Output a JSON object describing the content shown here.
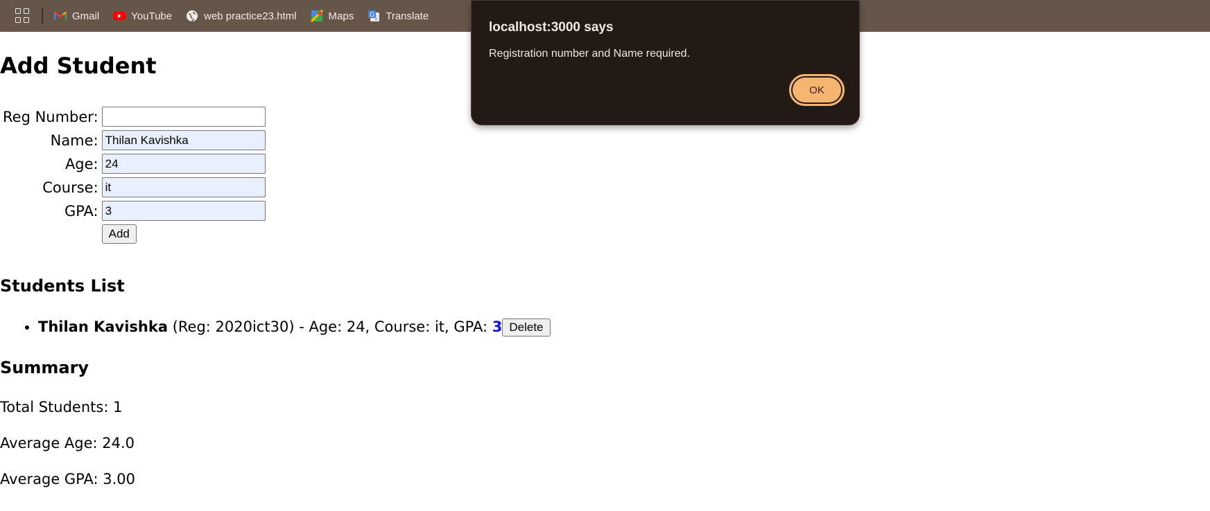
{
  "bookmarks_bar": {
    "items": [
      {
        "label": "Gmail",
        "icon": "gmail-icon"
      },
      {
        "label": "YouTube",
        "icon": "youtube-icon"
      },
      {
        "label": "web practice23.html",
        "icon": "globe-icon"
      },
      {
        "label": "Maps",
        "icon": "maps-icon"
      },
      {
        "label": "Translate",
        "icon": "translate-icon"
      }
    ]
  },
  "form": {
    "title": "Add Student",
    "fields": [
      {
        "label": "Reg Number:",
        "value": ""
      },
      {
        "label": "Name:",
        "value": "Thilan Kavishka"
      },
      {
        "label": "Age:",
        "value": "24"
      },
      {
        "label": "Course:",
        "value": "it"
      },
      {
        "label": "GPA:",
        "value": "3"
      }
    ],
    "add_label": "Add"
  },
  "students": {
    "heading": "Students List",
    "items": [
      {
        "name": "Thilan Kavishka",
        "details": "(Reg: 2020ict30) - Age: 24, Course: it, GPA: ",
        "gpa": "3",
        "delete_label": "Delete"
      }
    ]
  },
  "summary": {
    "heading": "Summary",
    "total": "Total Students: 1",
    "avg_age": "Average Age: 24.0",
    "avg_gpa": "Average GPA: 3.00"
  },
  "dialog": {
    "title": "localhost:3000 says",
    "message": "Registration number and Name required.",
    "ok_label": "OK"
  },
  "colors": {
    "bookmarks_bar_bg": "#66564a",
    "dialog_bg": "#241a15",
    "ok_button": "#f5b571",
    "gpa_value": "#1010e8",
    "autofill_bg": "#e8f0fe"
  }
}
